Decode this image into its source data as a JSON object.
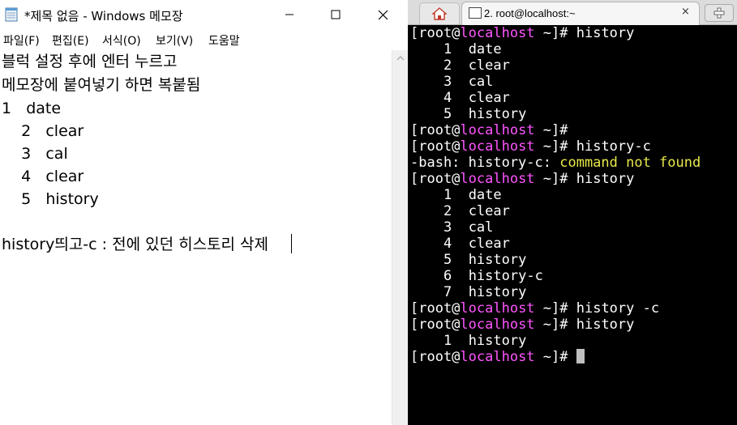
{
  "notepad": {
    "title": "*제목 없음 - Windows 메모장",
    "menu": [
      "파일(F)",
      "편집(E)",
      "서식(O)",
      "보기(V)",
      "도움말"
    ],
    "lines": [
      "블럭 설정 후에 엔터 누르고",
      "메모장에 붙여넣기 하면 복붙됨",
      "1   date",
      "    2   clear",
      "    3   cal",
      "    4   clear",
      "    5   history",
      "",
      "history띄고-c : 전에 있던 히스토리 삭제"
    ]
  },
  "terminal": {
    "tab_title": "2. root@localhost:~",
    "tab_close": "×",
    "user_open": "[root@",
    "host": "localhost",
    "prompt_tail": " ~]# ",
    "history1": [
      "1",
      "date",
      "2",
      "clear",
      "3",
      "cal",
      "4",
      "clear",
      "5",
      "history"
    ],
    "cmd_history": "history",
    "cmd_history_c": "history-c",
    "error_prefix": "-bash: history-c: ",
    "error_msg": "command not found",
    "history2": [
      "1",
      "date",
      "2",
      "clear",
      "3",
      "cal",
      "4",
      "clear",
      "5",
      "history",
      "6",
      "history-c",
      "7",
      "history"
    ],
    "cmd_history_space_c": "history -c",
    "history3": [
      "1",
      "history"
    ]
  }
}
